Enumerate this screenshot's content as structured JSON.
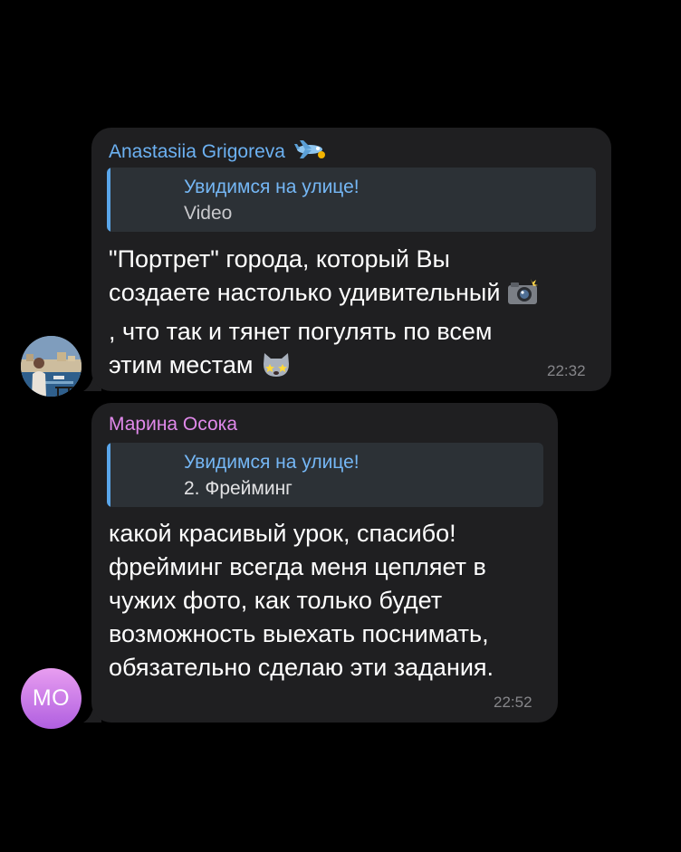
{
  "messages": [
    {
      "sender": "Anastasiia Grigoreva",
      "sender_emoji": "airplane-emoji",
      "reply": {
        "title": "Увидимся на улице!",
        "subtitle": "Video"
      },
      "lines": [
        "\"Портрет\" города, который Вы",
        "создаете настолько удивительный",
        ", что так и тянет погулять по всем",
        "этим местам"
      ],
      "inline_emojis": [
        "camera-flash-emoji",
        "star-struck-cat-emoji"
      ],
      "time": "22:32"
    },
    {
      "sender": "Марина Осока",
      "avatar_initials": "MO",
      "reply": {
        "title": "Увидимся на улице!",
        "subtitle": "2. Фрейминг"
      },
      "lines": [
        "какой красивый урок, спасибо!",
        "фрейминг всегда меня цепляет в",
        "чужих фото, как только будет",
        "возможность выехать поснимать,",
        "обязательно сделаю эти задания."
      ],
      "time": "22:52"
    }
  ],
  "colors": {
    "background": "#000000",
    "bubble": "#1f1f21",
    "sender1": "#6cb1f2",
    "sender2": "#e089ea",
    "reply_bar": "#5aa6ea",
    "reply_bg": "#2c3136",
    "timestamp": "#86868a"
  }
}
